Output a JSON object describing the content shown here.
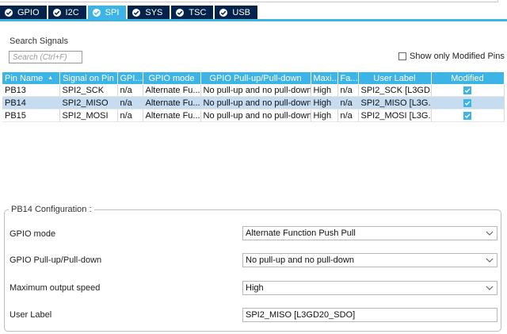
{
  "tabs": [
    {
      "label": "GPIO",
      "active": false
    },
    {
      "label": "I2C",
      "active": false
    },
    {
      "label": "SPI",
      "active": true
    },
    {
      "label": "SYS",
      "active": false
    },
    {
      "label": "TSC",
      "active": false
    },
    {
      "label": "USB",
      "active": false
    }
  ],
  "search": {
    "label": "Search Signals",
    "placeholder": "Search (Ctrl+F)",
    "show_modified_label": "Show only Modified Pins"
  },
  "table": {
    "headers": [
      "Pin Name",
      "Signal on Pin",
      "GPI...",
      "GPIO mode",
      "GPIO Pull-up/Pull-down",
      "Maxi...",
      "Fa...",
      "User Label",
      "Modified"
    ],
    "rows": [
      {
        "pin": "PB13",
        "signal": "SPI2_SCK",
        "gpio_output": "n/a",
        "mode": "Alternate Fu...",
        "pull": "No pull-up and no pull-down",
        "max_speed": "High",
        "fast": "n/a",
        "user_label": "SPI2_SCK [L3GD...",
        "modified": true,
        "selected": false
      },
      {
        "pin": "PB14",
        "signal": "SPI2_MISO",
        "gpio_output": "n/a",
        "mode": "Alternate Fu...",
        "pull": "No pull-up and no pull-down",
        "max_speed": "High",
        "fast": "n/a",
        "user_label": "SPI2_MISO [L3G...",
        "modified": true,
        "selected": true
      },
      {
        "pin": "PB15",
        "signal": "SPI2_MOSI",
        "gpio_output": "n/a",
        "mode": "Alternate Fu...",
        "pull": "No pull-up and no pull-down",
        "max_speed": "High",
        "fast": "n/a",
        "user_label": "SPI2_MOSI [L3G...",
        "modified": true,
        "selected": false
      }
    ]
  },
  "config": {
    "legend": "PB14 Configuration :",
    "gpio_mode_label": "GPIO mode",
    "gpio_mode_value": "Alternate Function Push Pull",
    "pull_label": "GPIO Pull-up/Pull-down",
    "pull_value": "No pull-up and no pull-down",
    "speed_label": "Maximum output speed",
    "speed_value": "High",
    "user_label_label": "User Label",
    "user_label_value": "SPI2_MISO [L3GD20_SDO]"
  },
  "colors": {
    "tab_bg": "#03234b",
    "accent": "#3cb4e6",
    "selected_row": "#c6dcf0"
  }
}
